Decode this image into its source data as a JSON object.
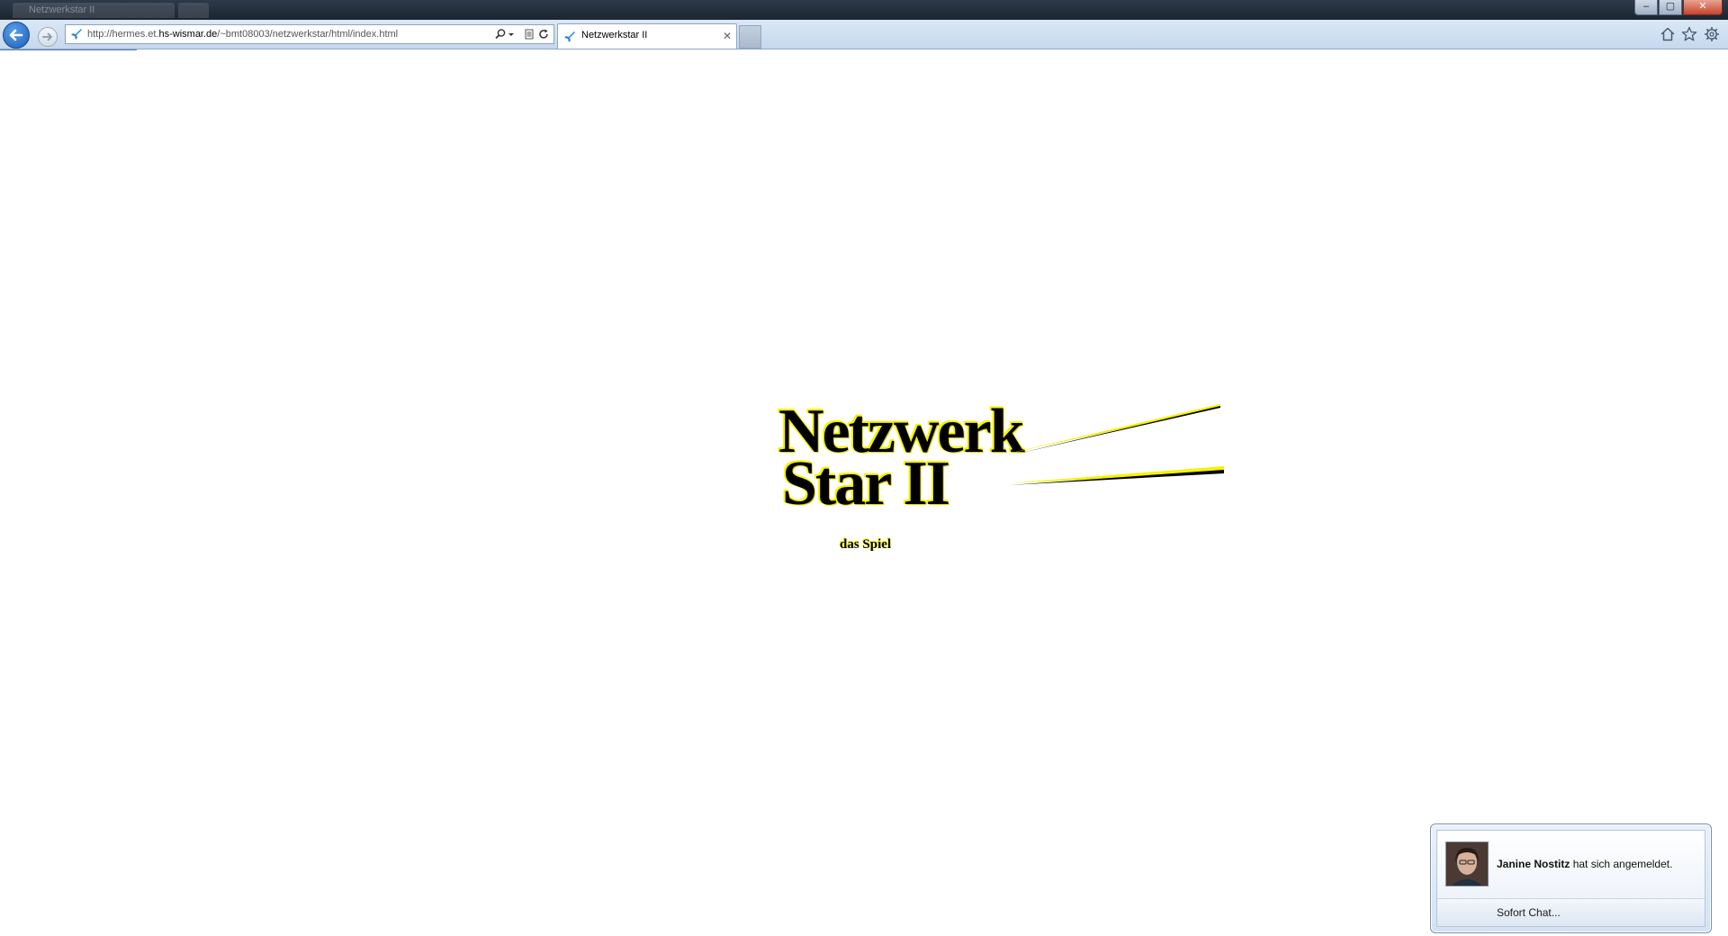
{
  "window": {
    "background_tabs": [
      "Netzwerkstar II",
      ""
    ],
    "controls": {
      "minimize": "–",
      "maximize": "▢",
      "close": "✕"
    }
  },
  "toolbar": {
    "back_icon": "back-arrow-icon",
    "forward_icon": "forward-arrow-icon",
    "address": {
      "url_prefix": "http://hermes.et.",
      "url_domain": "hs-wismar.de",
      "url_suffix": "/~bmt08003/netzwerkstar/html/index.html"
    },
    "address_icons": [
      "search-icon",
      "dropdown-icon",
      "compatibility-view-icon",
      "refresh-icon"
    ],
    "active_tab": {
      "title": "Netzwerkstar II",
      "close": "✕"
    },
    "right_icons": [
      "home-icon",
      "favorites-star-icon",
      "gear-icon"
    ]
  },
  "logo": {
    "line1": "Netzwerk",
    "line2": "Star II",
    "subtitle": "das Spiel",
    "accent_color": "#f5f200"
  },
  "notification": {
    "name": "Janine Nostitz",
    "message": " hat sich angemeldet.",
    "action": "Sofort Chat..."
  }
}
